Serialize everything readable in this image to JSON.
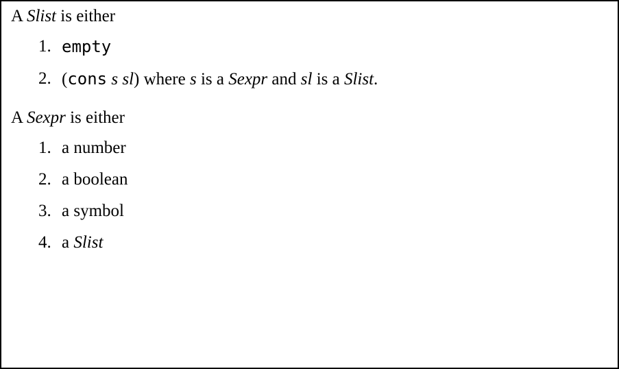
{
  "section1": {
    "intro_prefix": "A ",
    "intro_term": "Slist",
    "intro_suffix": " is either",
    "items": {
      "i1": {
        "tt": "empty"
      },
      "i2": {
        "open": "(",
        "cons": "cons",
        "sp": " ",
        "s": "s",
        "sl": "sl",
        "close": ")",
        "where_pre": " where ",
        "s2": "s",
        "is_a_1": " is a ",
        "sexpr": "Sexpr",
        "and": " and ",
        "sl2": "sl",
        "is_a_2": " is a ",
        "slist": "Slist",
        "period": "."
      }
    }
  },
  "section2": {
    "intro_prefix": "A ",
    "intro_term": "Sexpr",
    "intro_suffix": " is either",
    "items": {
      "i1": "a number",
      "i2": "a boolean",
      "i3": "a symbol",
      "i4_prefix": "a ",
      "i4_term": "Slist"
    }
  }
}
